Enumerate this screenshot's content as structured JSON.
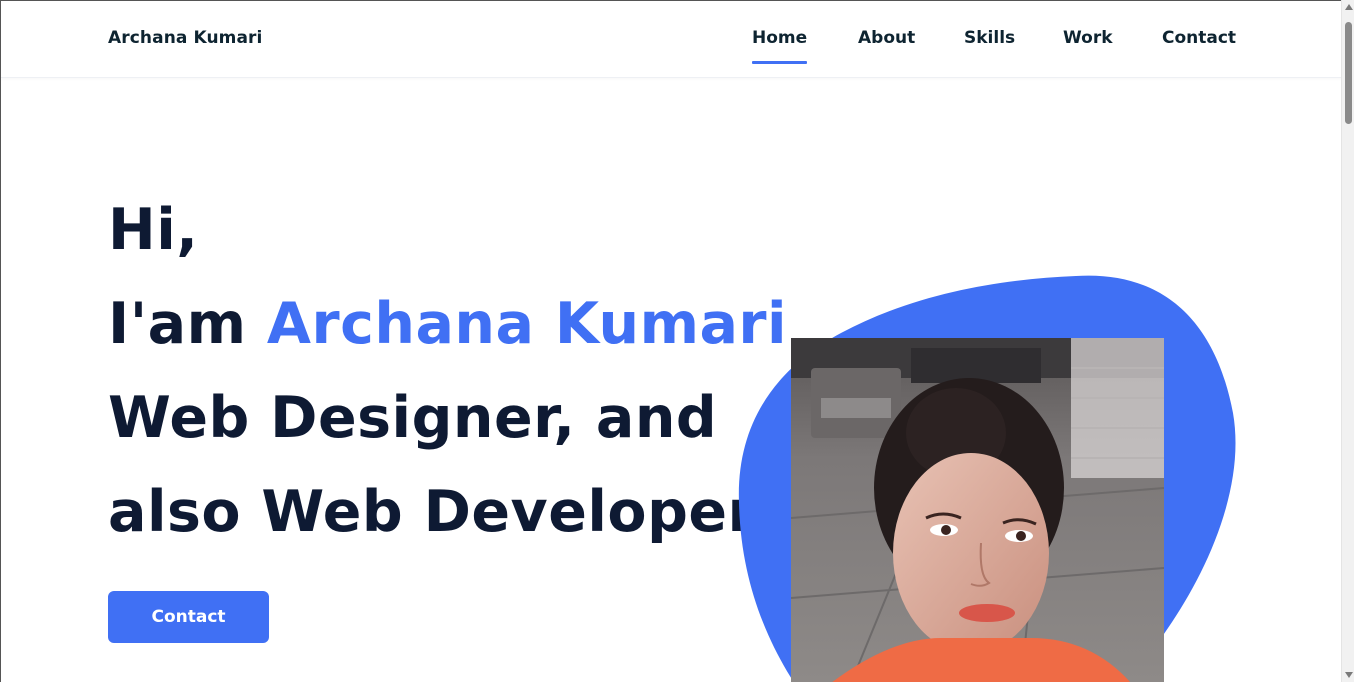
{
  "header": {
    "logo": "Archana Kumari",
    "nav": [
      {
        "label": "Home",
        "active": true
      },
      {
        "label": "About",
        "active": false
      },
      {
        "label": "Skills",
        "active": false
      },
      {
        "label": "Work",
        "active": false
      },
      {
        "label": "Contact",
        "active": false
      }
    ]
  },
  "hero": {
    "line1": "Hi,",
    "line2_prefix": "I'am ",
    "line2_name": "Archana Kumari",
    "line3": "Web Designer, and",
    "line4": "also Web Developer",
    "cta_label": "Contact"
  },
  "colors": {
    "accent": "#4070f4",
    "text": "#0e1a33"
  },
  "icons": {
    "scroll_up": "triangle-up",
    "scroll_down": "triangle-down"
  }
}
